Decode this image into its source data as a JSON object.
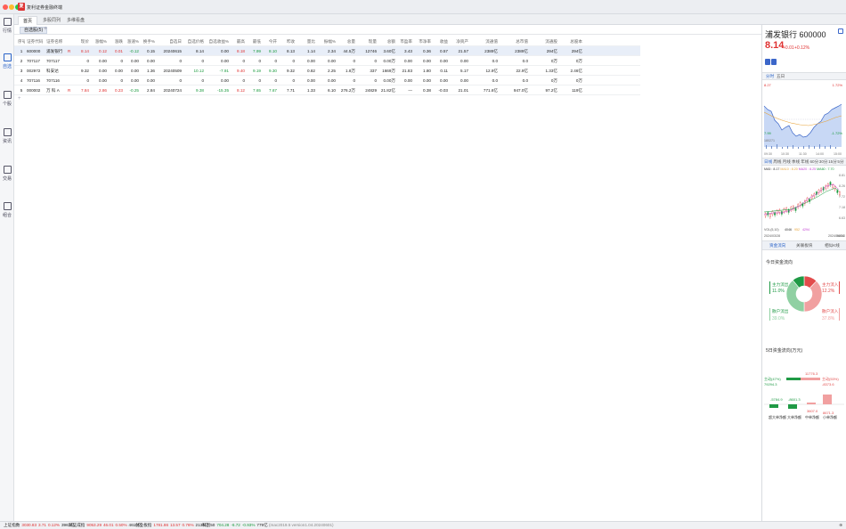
{
  "app": {
    "title": "复利证券金融终端",
    "logo_char": "复"
  },
  "tabs": [
    {
      "label": "首页"
    },
    {
      "label": "多股同列"
    },
    {
      "label": "多维看盘"
    }
  ],
  "sidebar": [
    {
      "label": "行情",
      "icon": "chart-icon"
    },
    {
      "label": "自选",
      "icon": "star-list-icon"
    },
    {
      "label": "个股",
      "icon": "bar-chart-icon"
    },
    {
      "label": "资讯",
      "icon": "news-icon"
    },
    {
      "label": "交易",
      "icon": "trade-icon"
    },
    {
      "label": "组合",
      "icon": "portfolio-icon"
    }
  ],
  "watchlist_tab": "自选股(5)",
  "table": {
    "headers": [
      "序号",
      "证券代码",
      "证券名称",
      "",
      "现价",
      "涨幅%",
      "涨跌",
      "涨速%",
      "换手%",
      "自选日",
      "自选价格",
      "自选收益%",
      "最高",
      "最低",
      "今开",
      "昨收",
      "量比",
      "振幅%",
      "总量",
      "现量",
      "总额",
      "市盈率",
      "市净率",
      "收益",
      "净资产",
      "流通值",
      "总市值",
      "流通股",
      "总股本"
    ],
    "rows": [
      [
        "1",
        "600000",
        "浦发银行",
        "R",
        "8.14",
        "0.12",
        "0.01",
        "-0.12",
        "0.15",
        "20240615",
        "8.14",
        "0.00",
        "8.18",
        "7.99",
        "8.10",
        "8.13",
        "1.14",
        "2.34",
        "44.5万",
        "12746",
        "3.60亿",
        "3.43",
        "0.36",
        "0.57",
        "21.57",
        "2389亿",
        "2389亿",
        "294亿",
        "294亿"
      ],
      [
        "2",
        "707117",
        "707117",
        "",
        "0",
        "0.00",
        "0",
        "0.00",
        "0.00",
        "0",
        "0",
        "0.00",
        "0",
        "0",
        "0",
        "0",
        "0.00",
        "0.00",
        "0",
        "0",
        "0.00万",
        "0.00",
        "0.00",
        "0.00",
        "0.00",
        "0.0",
        "0.0",
        "0万",
        "0万"
      ],
      [
        "3",
        "002972",
        "科安达",
        "",
        "9.32",
        "0.00",
        "0.00",
        "0.00",
        "1.36",
        "20240509",
        "10.12",
        "-7.91",
        "9.40",
        "9.19",
        "9.30",
        "9.32",
        "0.82",
        "2.25",
        "1.8万",
        "337",
        "1669万",
        "21.83",
        "1.80",
        "0.11",
        "5.17",
        "12.9亿",
        "22.9亿",
        "1.33亿",
        "2.46亿"
      ],
      [
        "4",
        "707116",
        "707116",
        "",
        "0",
        "0.00",
        "0",
        "0.00",
        "0.00",
        "0",
        "0",
        "0.00",
        "0",
        "0",
        "0",
        "0",
        "0.00",
        "0.00",
        "0",
        "0",
        "0.00万",
        "0.00",
        "0.00",
        "0.00",
        "0.00",
        "0.0",
        "0.0",
        "0万",
        "0万"
      ],
      [
        "5",
        "000002",
        "万 科 A",
        "R",
        "7.84",
        "2.86",
        "0.23",
        "-0.25",
        "2.84",
        "20240724",
        "9.38",
        "-15.35",
        "8.12",
        "7.65",
        "7.67",
        "7.71",
        "1.33",
        "6.10",
        "276.2万",
        "24829",
        "21.82亿",
        "—",
        "0.38",
        "-0.03",
        "21.01",
        "771.6亿",
        "947.0亿",
        "97.2亿",
        "119亿"
      ]
    ]
  },
  "stock": {
    "name": "浦发银行",
    "code": "600000",
    "price": "8.14",
    "change": "+0.01",
    "change_pct": "+0.12%"
  },
  "panel_tabs": [
    "分时",
    "五日"
  ],
  "intraday": {
    "high_price": "8.27",
    "low_price": "7.99",
    "high_pct": "1.72%",
    "low_pct": "-1.72%",
    "volume_label": "180271",
    "times": [
      "09:30",
      "10:30",
      "11:30",
      "14:00",
      "15:00"
    ]
  },
  "period_tabs": [
    "日线",
    "周线",
    "月线",
    "季线",
    "年线",
    "60分",
    "30分",
    "15分",
    "5分"
  ],
  "ma_legend": {
    "ma5": "MA5 : 8.17",
    "ma10": "MA10 : 8.20",
    "ma20": "MA20 : 8.25",
    "ma60": "MA60 : 7.70"
  },
  "kline_prices": [
    "8.81",
    "8.26",
    "7.72",
    "7.18",
    "6.63"
  ],
  "vol_legend": {
    "label": "VOL(5,10)",
    "v1": "4046",
    "v2": "952",
    "v3": "4294"
  },
  "vol_ticks": [
    "34853",
    "17426"
  ],
  "kline_dates": [
    "2024/03/28",
    "2024/06/14"
  ],
  "fund_tabs": [
    "资金流向",
    "关联板块",
    "相似K线"
  ],
  "fund": {
    "title": "今日资金流向",
    "main_out": {
      "label": "主力流出",
      "value": "11.0%"
    },
    "main_in": {
      "label": "主力流入",
      "value": "12.2%"
    },
    "retail_out": {
      "label": "散户流出",
      "value": "39.0%"
    },
    "retail_in": {
      "label": "散户流入",
      "value": "37.8%"
    },
    "donut": [
      {
        "v": 12.2,
        "c": "#e24b4b"
      },
      {
        "v": 37.8,
        "c": "#f1a0a0"
      },
      {
        "v": 39.0,
        "c": "#8fd0a2"
      },
      {
        "v": 11.0,
        "c": "#1f9a45"
      }
    ]
  },
  "five_day": {
    "title": "5日资金流向(万元)",
    "main_in_label": "主动(47%)",
    "main_in_value": "79294.3",
    "main_out_label": "主动(53%)",
    "main_out_value": "-8373.6",
    "bars": [
      {
        "label": "超大单净额",
        "value": "-5784.9"
      },
      {
        "label": "大单净额",
        "value": "-8601.3"
      },
      {
        "label": "中单净额",
        "value": "3607.0"
      },
      {
        "label": "小单净额",
        "value": "8671.3"
      }
    ],
    "top_value": "11776.3"
  },
  "status": {
    "indices": [
      {
        "name": "上证指数",
        "value": "3030.83",
        "chg": "3.71",
        "pct": "0.12%",
        "vol": "3963亿",
        "color": "#e03131"
      },
      {
        "name": "深证成指",
        "value": "9053.29",
        "chg": "46.01",
        "pct": "0.50%",
        "vol": "4619亿",
        "color": "#e03131"
      },
      {
        "name": "创业板指",
        "value": "1781.86",
        "chg": "13.57",
        "pct": "0.76%",
        "vol": "2136亿",
        "color": "#e03131"
      },
      {
        "name": "科创50",
        "value": "704.28",
        "chg": "-6.72",
        "pct": "-0.93%",
        "vol": "779亿",
        "color": "#1a9a3e"
      }
    ],
    "version": "(mac2019.5 version1.04.20240601)",
    "page": "⊕"
  }
}
